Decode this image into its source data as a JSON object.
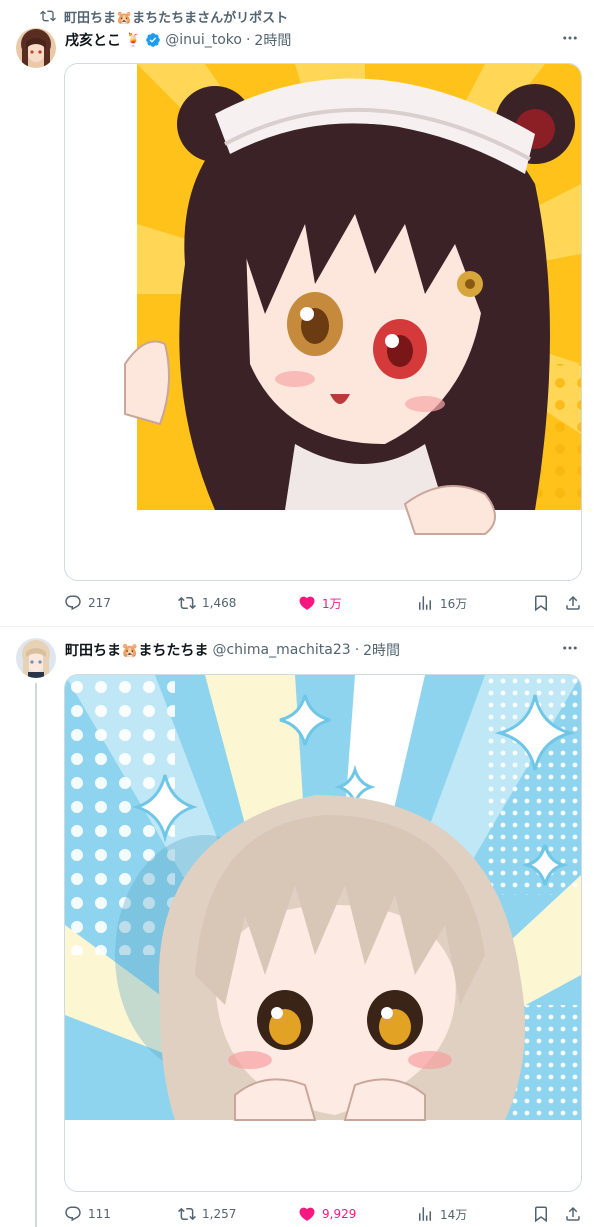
{
  "repost_banner": {
    "text": "町田ちま🐹まちたちまさんがリポスト"
  },
  "posts": [
    {
      "author_name": "戌亥とこ",
      "name_emoji": "🍹",
      "handle": "@inui_toko",
      "dot": "·",
      "time": "2時間",
      "stats": {
        "replies": "217",
        "reposts": "1,468",
        "likes": "1万",
        "views": "16万"
      },
      "liked": true,
      "media_alt": "anime girl with dark hair peeking over a frame, yellow sunburst background"
    },
    {
      "author_name": "町田ちま🐹まちたちま",
      "handle": "@chima_machita23",
      "dot": "·",
      "time": "2時間",
      "stats": {
        "replies": "111",
        "reposts": "1,257",
        "likes": "9,929",
        "views": "14万"
      },
      "liked": true,
      "media_alt": "anime girl with light hair peeking from bottom, blue sparkle background"
    }
  ],
  "colors": {
    "text_primary": "#0f1419",
    "text_secondary": "#536471",
    "like_pink": "#f91880",
    "verified_blue": "#1d9bf0",
    "border": "#cfd9de"
  },
  "icons": [
    "repost-icon",
    "verified-badge-icon",
    "more-icon",
    "reply-icon",
    "like-icon",
    "views-icon",
    "bookmark-icon",
    "share-icon"
  ]
}
